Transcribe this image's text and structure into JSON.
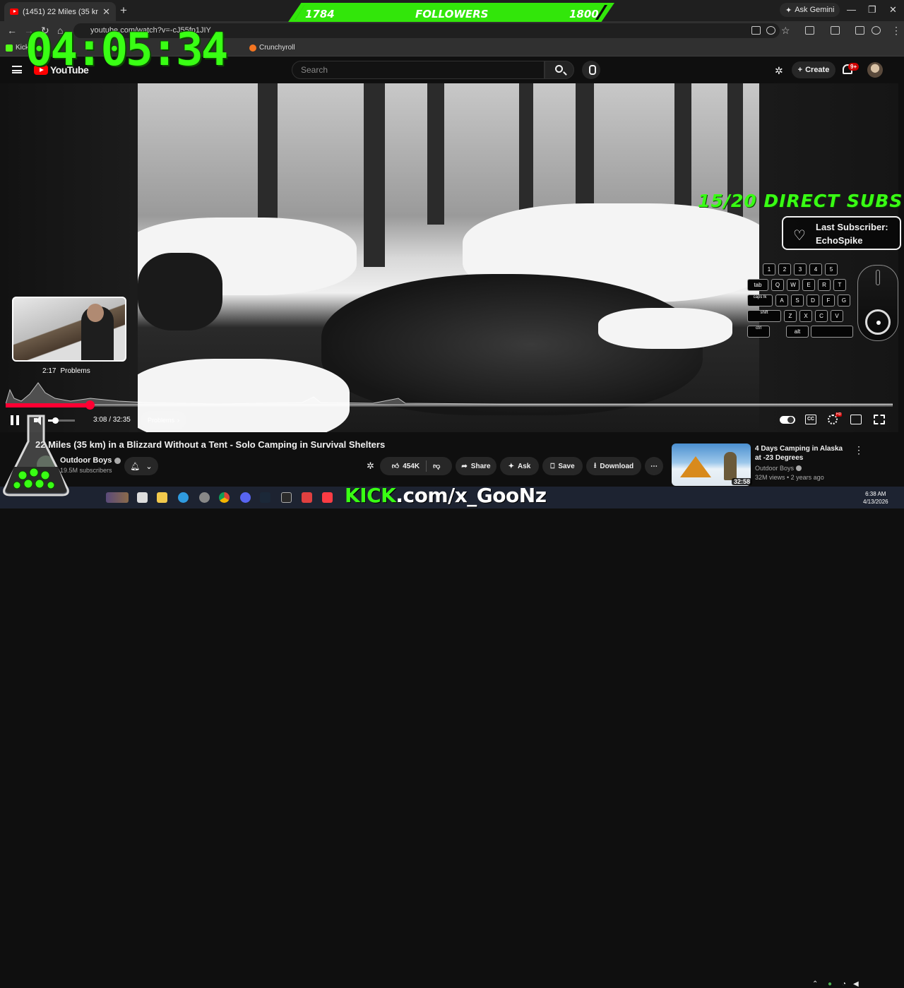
{
  "browser": {
    "tab_title": "(1451) 22 Miles (35 km) in a...",
    "url": "youtube.com/watch?v=-cJ55fp1JIY",
    "ask_gemini": "Ask Gemini",
    "bookmarks": [
      "Kick",
      "Crunchyroll"
    ]
  },
  "youtube": {
    "logo_text": "YouTube",
    "search_placeholder": "Search",
    "create_label": "Create",
    "notification_badge": "9+"
  },
  "player": {
    "thumbnail_time": "2:17",
    "thumbnail_chapter": "Problems",
    "progress_fraction": 0.095,
    "volume_fraction": 0.25,
    "time_display": "3:08 / 32:35",
    "chapter_chip": "Problems",
    "cc_label": "CC",
    "hd_badge": "HD"
  },
  "video": {
    "title": "22 Miles (35 km) in a Blizzard Without a Tent - Solo Camping in Survival Shelters",
    "channel": "Outdoor Boys",
    "subscribers": "19.5M subscribers",
    "likes": "454K",
    "share": "Share",
    "ask": "Ask",
    "save": "Save",
    "download": "Download"
  },
  "recommended": {
    "title": "4 Days Camping in Alaska at -23 Degrees",
    "channel": "Outdoor Boys",
    "meta": "32M views • 2 years ago",
    "duration": "32:58"
  },
  "overlay": {
    "followers_current": "1784",
    "followers_label": "FOLLOWERS",
    "followers_goal": "1800",
    "timer": "04:05:34",
    "direct_subs": "15/20 DIRECT SUBS",
    "last_sub_label": "Last Subscriber:",
    "last_sub_name": "EchoSpike",
    "kick_brand": "KICK",
    "kick_rest": ".com/x_GooNz",
    "keys": {
      "row1": [
        "1",
        "2",
        "3",
        "4",
        "5"
      ],
      "row2": [
        "tab",
        "Q",
        "W",
        "E",
        "R",
        "T"
      ],
      "row3": [
        "caps lk",
        "A",
        "S",
        "D",
        "F",
        "G"
      ],
      "row4": [
        "shift",
        "Z",
        "X",
        "C",
        "V"
      ],
      "row5": [
        "ctrl",
        "alt",
        ""
      ]
    }
  },
  "taskbar": {
    "time": "6:38 AM",
    "date": "4/13/2026"
  },
  "colors": {
    "accent_green": "#39ff14",
    "yt_red": "#ff0033"
  }
}
